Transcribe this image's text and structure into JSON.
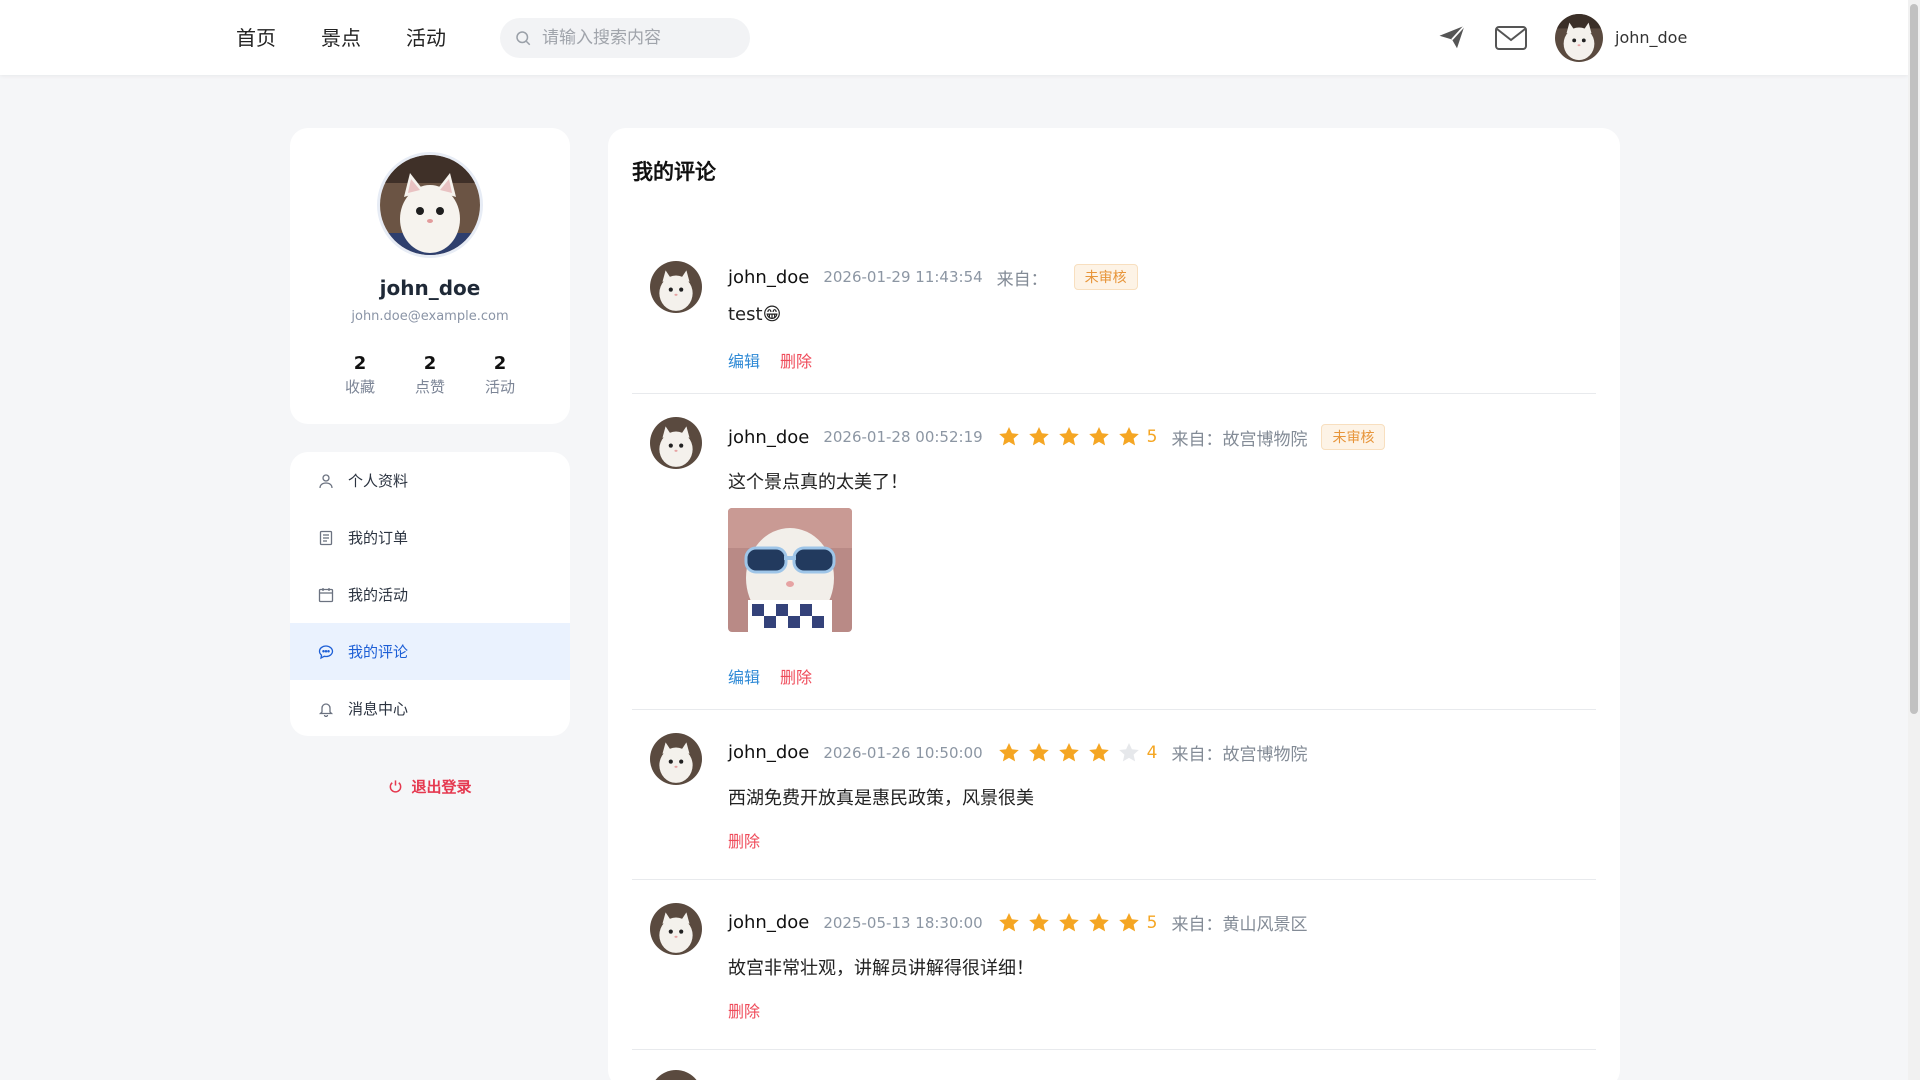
{
  "header": {
    "nav": [
      "首页",
      "景点",
      "活动"
    ],
    "search_placeholder": "请输入搜索内容",
    "username": "john_doe"
  },
  "profile": {
    "name": "john_doe",
    "email": "john.doe@example.com",
    "stats": [
      {
        "value": "2",
        "label": "收藏"
      },
      {
        "value": "2",
        "label": "点赞"
      },
      {
        "value": "2",
        "label": "活动"
      }
    ]
  },
  "menu": {
    "items": [
      "个人资料",
      "我的订单",
      "我的活动",
      "我的评论",
      "消息中心"
    ],
    "active_index": 3,
    "logout": "退出登录"
  },
  "main": {
    "title": "我的评论",
    "comments": [
      {
        "user": "john_doe",
        "time": "2026-01-29 11:43:54",
        "rating": null,
        "from": "来自：",
        "badge": "未审核",
        "text": "test😁",
        "edit": "编辑",
        "delete": "删除"
      },
      {
        "user": "john_doe",
        "time": "2026-01-28 00:52:19",
        "rating": 5,
        "rating_text": "5",
        "from": "来自：故宫博物院",
        "badge": "未审核",
        "text": "这个景点真的太美了！",
        "edit": "编辑",
        "delete": "删除"
      },
      {
        "user": "john_doe",
        "time": "2026-01-26 10:50:00",
        "rating": 4,
        "rating_text": "4",
        "from": "来自：故宫博物院",
        "badge": null,
        "text": "西湖免费开放真是惠民政策，风景很美",
        "edit": null,
        "delete": "删除"
      },
      {
        "user": "john_doe",
        "time": "2025-05-13 18:30:00",
        "rating": 5,
        "rating_text": "5",
        "from": "来自：黄山风景区",
        "badge": null,
        "text": "故宫非常壮观，讲解员讲解得很详细！",
        "edit": null,
        "delete": "删除"
      }
    ]
  },
  "colors": {
    "accent": "#1d5fd6",
    "star": "#f5a623",
    "star_empty": "#e6e8eb",
    "danger": "#ef4b5a",
    "link": "#2f8ad6",
    "badge": "#e7953a"
  }
}
